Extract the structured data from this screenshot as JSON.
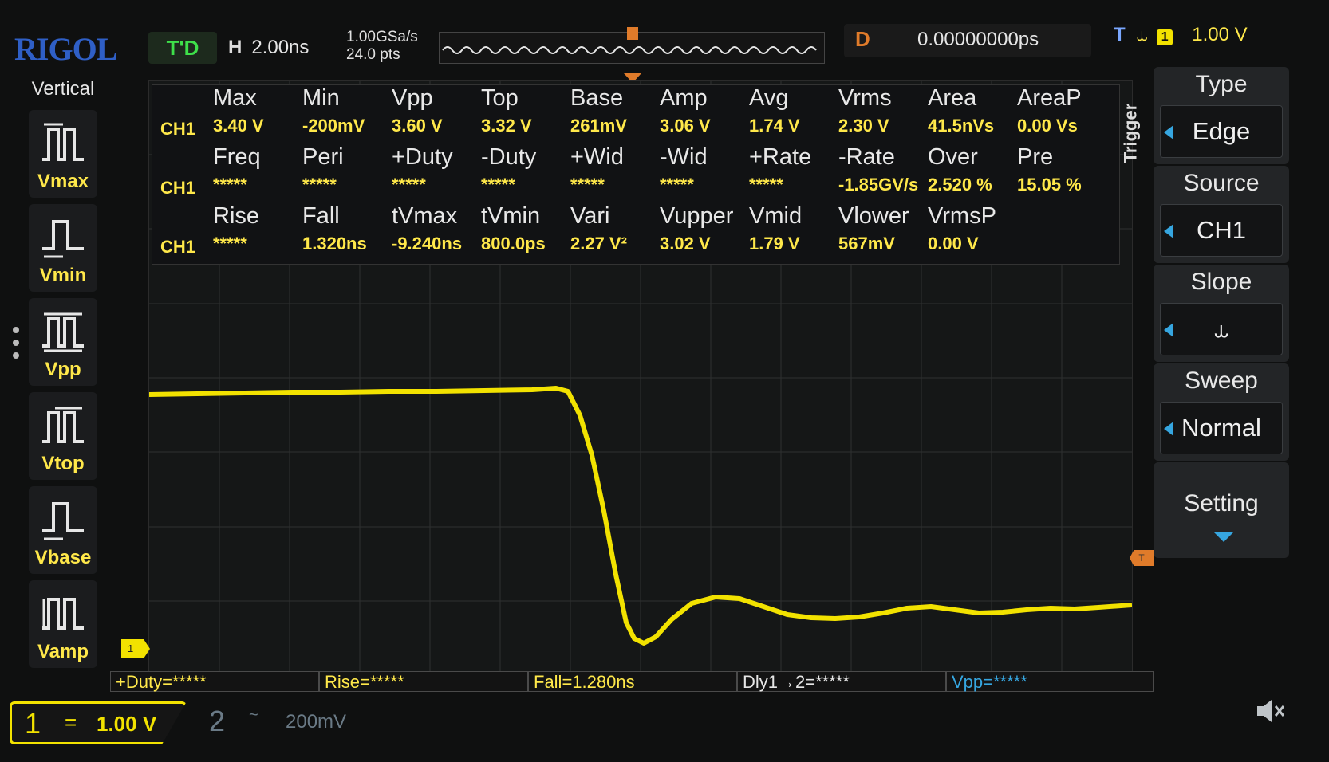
{
  "topbar": {
    "brand": "RIGOL",
    "run_status": "T'D",
    "horizontal_label": "H",
    "timebase": "2.00ns",
    "sample_rate": "1.00GSa/s",
    "memory_depth": "24.0  pts",
    "delay_label": "D",
    "delay_value": "0.00000000ps",
    "trigger_label": "T",
    "trigger_channel": "1",
    "trigger_level": "1.00 V"
  },
  "vertical_menu": {
    "title": "Vertical",
    "items": [
      {
        "label": "Vmax",
        "icon": "vmax-icon"
      },
      {
        "label": "Vmin",
        "icon": "vmin-icon"
      },
      {
        "label": "Vpp",
        "icon": "vpp-icon"
      },
      {
        "label": "Vtop",
        "icon": "vtop-icon"
      },
      {
        "label": "Vbase",
        "icon": "vbase-icon"
      },
      {
        "label": "Vamp",
        "icon": "vamp-icon"
      }
    ]
  },
  "measurements": {
    "rows": [
      {
        "channel": "CH1",
        "items": [
          {
            "name": "Max",
            "value": "3.40 V"
          },
          {
            "name": "Min",
            "value": "-200mV"
          },
          {
            "name": "Vpp",
            "value": "3.60 V"
          },
          {
            "name": "Top",
            "value": "3.32 V"
          },
          {
            "name": "Base",
            "value": "261mV"
          },
          {
            "name": "Amp",
            "value": "3.06 V"
          },
          {
            "name": "Avg",
            "value": "1.74 V"
          },
          {
            "name": "Vrms",
            "value": "2.30 V"
          },
          {
            "name": "Area",
            "value": "41.5nVs"
          },
          {
            "name": "AreaP",
            "value": "0.00 Vs"
          }
        ]
      },
      {
        "channel": "CH1",
        "items": [
          {
            "name": "Freq",
            "value": "*****"
          },
          {
            "name": "Peri",
            "value": "*****"
          },
          {
            "name": "+Duty",
            "value": "*****"
          },
          {
            "name": "-Duty",
            "value": "*****"
          },
          {
            "name": "+Wid",
            "value": "*****"
          },
          {
            "name": "-Wid",
            "value": "*****"
          },
          {
            "name": "+Rate",
            "value": "*****"
          },
          {
            "name": "-Rate",
            "value": "-1.85GV/s"
          },
          {
            "name": "Over",
            "value": "2.520 %"
          },
          {
            "name": "Pre",
            "value": "15.05 %"
          }
        ]
      },
      {
        "channel": "CH1",
        "items": [
          {
            "name": "Rise",
            "value": "*****"
          },
          {
            "name": "Fall",
            "value": "1.320ns"
          },
          {
            "name": "tVmax",
            "value": "-9.240ns"
          },
          {
            "name": "tVmin",
            "value": "800.0ps"
          },
          {
            "name": "Vari",
            "value": "2.27 V²"
          },
          {
            "name": "Vupper",
            "value": "3.02 V"
          },
          {
            "name": "Vmid",
            "value": "1.79 V"
          },
          {
            "name": "Vlower",
            "value": "567mV"
          },
          {
            "name": "VrmsP",
            "value": "0.00 V"
          }
        ]
      }
    ]
  },
  "trigger_menu": {
    "title": "Trigger",
    "items": [
      {
        "header": "Type",
        "value": "Edge"
      },
      {
        "header": "Source",
        "value": "CH1"
      },
      {
        "header": "Slope",
        "value": "⥿"
      },
      {
        "header": "Sweep",
        "value": "Normal"
      }
    ],
    "setting": "Setting"
  },
  "markers": {
    "ch1": "1",
    "trigger": "T"
  },
  "quick_measure": {
    "duty": "+Duty=*****",
    "rise": "Rise=*****",
    "fall": "Fall=1.280ns",
    "delay": "Dly1→2=*****",
    "vpp": "Vpp=*****"
  },
  "channels": {
    "ch1": {
      "number": "1",
      "coupling": "=",
      "scale": "1.00 V"
    },
    "ch2": {
      "number": "2",
      "coupling": "~",
      "scale": "200mV"
    }
  },
  "colors": {
    "ch1": "#f2e200",
    "trigger": "#e07b2a",
    "accent": "#36a6e0",
    "brand": "#2f5fc6"
  }
}
